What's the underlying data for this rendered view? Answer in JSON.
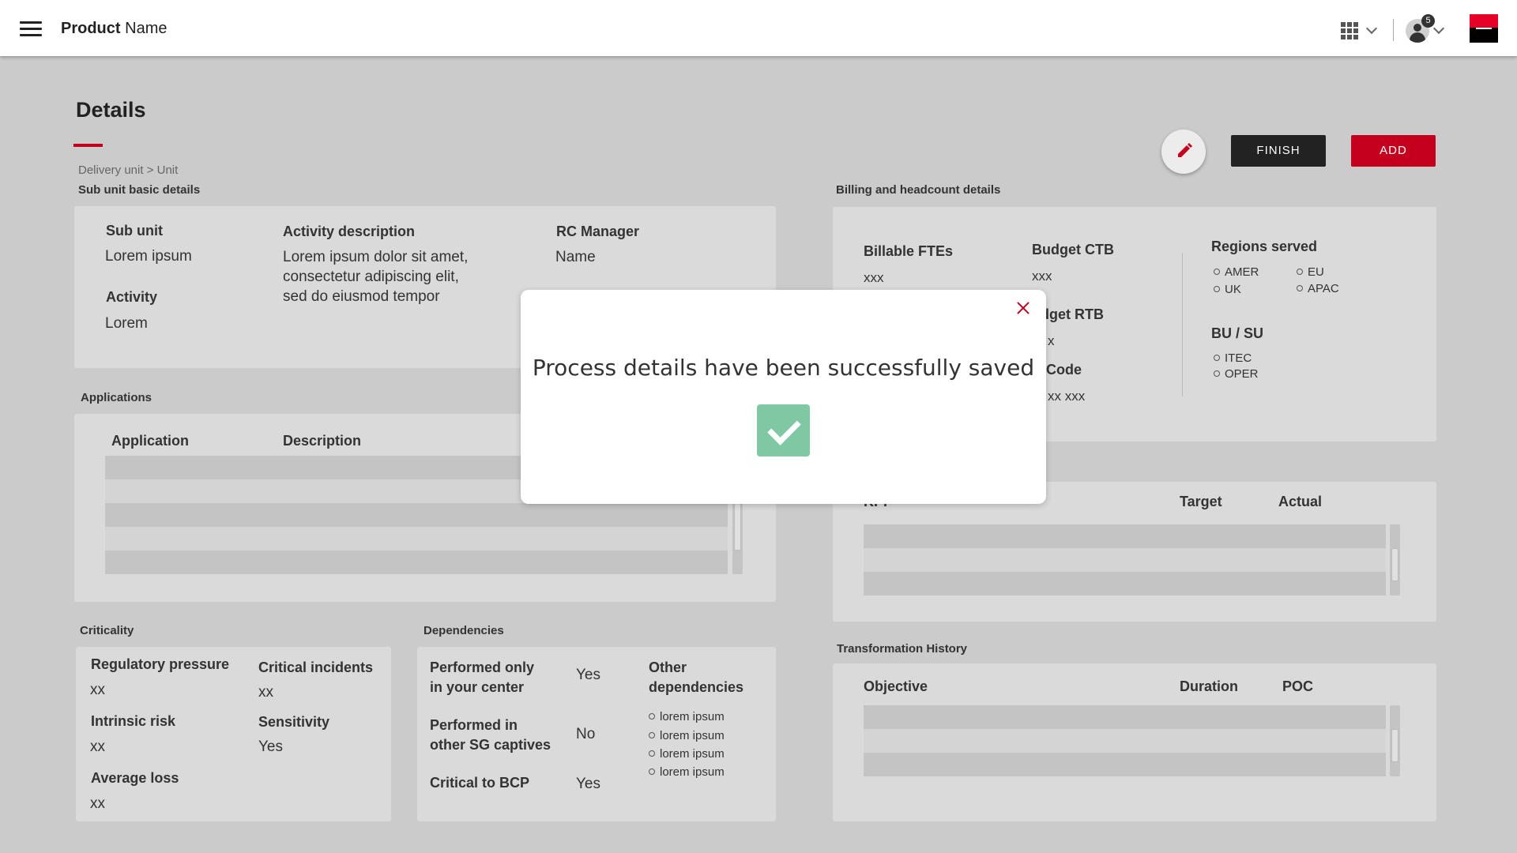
{
  "header": {
    "brand_bold": "Product",
    "brand_rest": "Name",
    "notification_count": "5"
  },
  "page": {
    "title": "Details",
    "breadcrumb": "Delivery unit > Unit"
  },
  "actions": {
    "finish_label": "FINISH",
    "add_label": "ADD"
  },
  "sub_unit": {
    "section_label": "Sub unit basic details",
    "sub_unit_label": "Sub unit",
    "sub_unit_value": "Lorem ipsum",
    "activity_label": "Activity",
    "activity_value": "Lorem",
    "activity_description_label": "Activity description",
    "activity_description_lines": [
      "Lorem ipsum dolor sit amet,",
      "consectetur adipiscing elit,",
      "sed do eiusmod tempor"
    ],
    "rc_manager_label": "RC Manager",
    "rc_manager_value": "Name"
  },
  "applications": {
    "section_label": "Applications",
    "col_application": "Application",
    "col_description": "Description"
  },
  "criticality": {
    "section_label": "Criticality",
    "regulatory_pressure_label": "Regulatory pressure",
    "regulatory_pressure_value": "xx",
    "critical_incidents_label": "Critical incidents",
    "critical_incidents_value": "xx",
    "intrinsic_risk_label": "Intrinsic risk",
    "intrinsic_risk_value": "xx",
    "sensitivity_label": "Sensitivity",
    "sensitivity_value": "Yes",
    "average_loss_label": "Average loss",
    "average_loss_value": "xx"
  },
  "dependencies": {
    "section_label": "Dependencies",
    "performed_only_label": [
      "Performed only",
      "in your center"
    ],
    "performed_only_value": "Yes",
    "performed_in_other_label": [
      "Performed in",
      "other SG captives"
    ],
    "performed_in_other_value": "No",
    "critical_bcp_label": "Critical to BCP",
    "critical_bcp_value": "Yes",
    "other_label": [
      "Other",
      "dependencies"
    ],
    "other_items": [
      "lorem ipsum",
      "lorem ipsum",
      "lorem ipsum",
      "lorem ipsum"
    ]
  },
  "billing": {
    "section_label": "Billing and headcount details",
    "billable_ftes_label": "Billable FTEs",
    "billable_ftes_value": "xxx",
    "budget_ctb_label": "Budget CTB",
    "budget_ctb_value": "xxx",
    "budget_rtb_label_partial": "udget RTB",
    "budget_rtb_value_partial": "x",
    "rc_code_label_partial": "C Code",
    "rc_code_value_partial": "xx xxx",
    "regions_label": "Regions served",
    "regions": [
      "AMER",
      "EU",
      "UK",
      "APAC"
    ],
    "bu_su_label": "BU / SU",
    "bu_su": [
      "ITEC",
      "OPER"
    ]
  },
  "kpi": {
    "col_kpi_partial": "KPI",
    "col_target": "Target",
    "col_actual": "Actual"
  },
  "transformation": {
    "section_label": "Transformation History",
    "col_objective": "Objective",
    "col_duration": "Duration",
    "col_poc": "POC"
  },
  "modal": {
    "message": "Process details have been successfully saved"
  },
  "colors": {
    "brand_red": "#c4001e",
    "success_green": "#80c8a3",
    "overlay_gray": "#cbcbcb"
  }
}
